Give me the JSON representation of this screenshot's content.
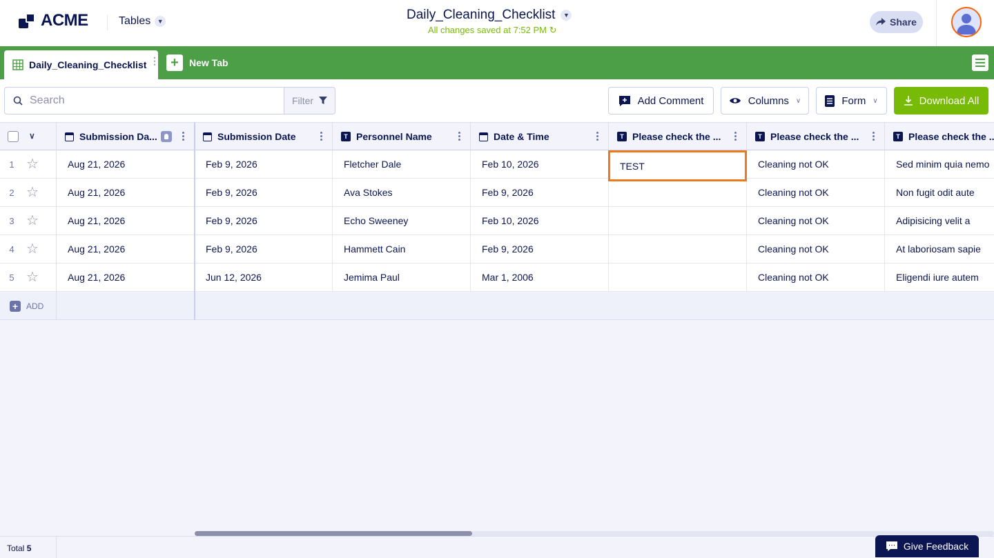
{
  "header": {
    "logo_text": "ACME",
    "tables_label": "Tables",
    "title": "Daily_Cleaning_Checklist",
    "save_status": "All changes saved at 7:52 PM",
    "share_label": "Share"
  },
  "tabs": {
    "active_tab": "Daily_Cleaning_Checklist",
    "new_tab_label": "New Tab"
  },
  "toolbar": {
    "search_placeholder": "Search",
    "filter_label": "Filter",
    "add_comment_label": "Add Comment",
    "columns_label": "Columns",
    "form_label": "Form",
    "download_label": "Download All"
  },
  "table": {
    "columns": [
      {
        "label": "Submission Da...",
        "icon": "calendar-icon"
      },
      {
        "label": "Submission Date",
        "icon": "calendar-icon"
      },
      {
        "label": "Personnel Name",
        "icon": "text-icon"
      },
      {
        "label": "Date & Time",
        "icon": "calendar-icon"
      },
      {
        "label": "Please check the ...",
        "icon": "text-icon"
      },
      {
        "label": "Please check the ...",
        "icon": "text-icon"
      },
      {
        "label": "Please check the ...",
        "icon": "text-icon"
      }
    ],
    "rows": [
      {
        "num": "1",
        "cells": [
          "Aug 21, 2026",
          "Feb 9, 2026",
          "Fletcher Dale",
          "Feb 10, 2026",
          "TEST",
          "Cleaning not OK",
          "Sed minim quia nemo"
        ]
      },
      {
        "num": "2",
        "cells": [
          "Aug 21, 2026",
          "Feb 9, 2026",
          "Ava Stokes",
          "Feb 9, 2026",
          "",
          "Cleaning not OK",
          "Non fugit odit aute"
        ]
      },
      {
        "num": "3",
        "cells": [
          "Aug 21, 2026",
          "Feb 9, 2026",
          "Echo Sweeney",
          "Feb 10, 2026",
          "",
          "Cleaning not OK",
          "Adipisicing velit a"
        ]
      },
      {
        "num": "4",
        "cells": [
          "Aug 21, 2026",
          "Feb 9, 2026",
          "Hammett Cain",
          "Feb 9, 2026",
          "",
          "Cleaning not OK",
          "At laboriosam sapie"
        ]
      },
      {
        "num": "5",
        "cells": [
          "Aug 21, 2026",
          "Jun 12, 2026",
          "Jemima Paul",
          "Mar 1, 2006",
          "",
          "Cleaning not OK",
          "Eligendi iure autem"
        ]
      }
    ],
    "add_label": "ADD"
  },
  "footer": {
    "total_label": "Total",
    "total_count": "5",
    "feedback_label": "Give Feedback"
  },
  "colors": {
    "brand_green": "#4c9e47",
    "download_green": "#78bb07",
    "selection_orange": "#ec7a1c",
    "navy": "#0a1551"
  }
}
